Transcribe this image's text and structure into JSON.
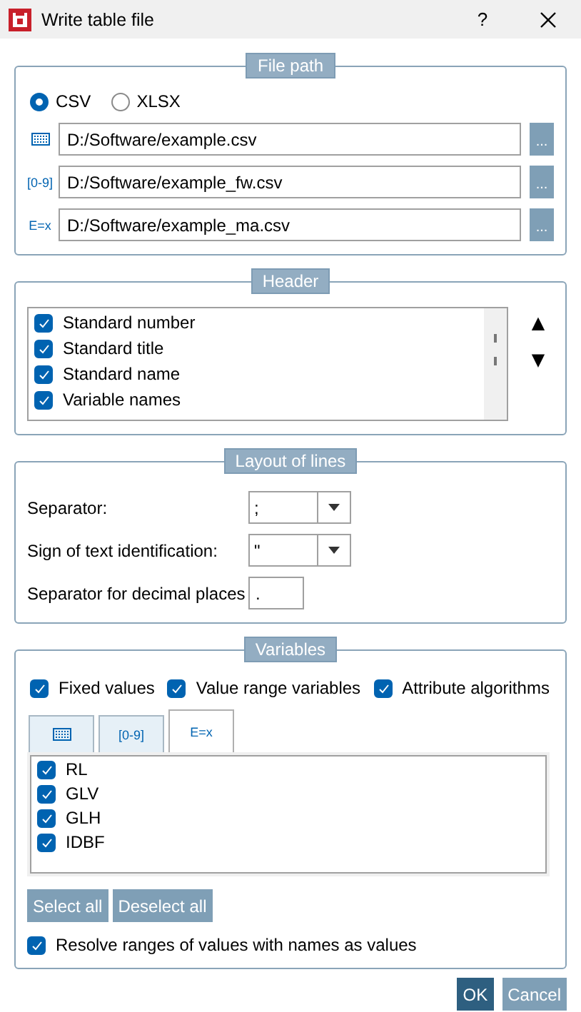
{
  "window": {
    "title": "Write table file",
    "help": "?"
  },
  "file_path": {
    "legend": "File path",
    "formats": [
      {
        "label": "CSV",
        "selected": true
      },
      {
        "label": "XLSX",
        "selected": false
      }
    ],
    "paths": [
      {
        "kind": "grid",
        "value": "D:/Software/example.csv",
        "browse": "..."
      },
      {
        "kind": "text",
        "icon_text": "[0-9]",
        "value": "D:/Software/example_fw.csv",
        "browse": "..."
      },
      {
        "kind": "text",
        "icon_text": "E=x",
        "value": "D:/Software/example_ma.csv",
        "browse": "..."
      }
    ]
  },
  "header": {
    "legend": "Header",
    "items": [
      {
        "label": "Standard number",
        "checked": true
      },
      {
        "label": "Standard title",
        "checked": true
      },
      {
        "label": "Standard name",
        "checked": true
      },
      {
        "label": "Variable names",
        "checked": true
      }
    ],
    "move_up": "▲",
    "move_down": "▼"
  },
  "layout_of_lines": {
    "legend": "Layout of lines",
    "fields": [
      {
        "kind": "combo",
        "label": "Separator:",
        "value": ";"
      },
      {
        "kind": "combo",
        "label": "Sign of text identification:",
        "value": "\""
      },
      {
        "kind": "text",
        "label": "Separator for decimal places",
        "value": "."
      }
    ]
  },
  "variables": {
    "legend": "Variables",
    "filters": [
      {
        "label": "Fixed values",
        "checked": true
      },
      {
        "label": "Value range variables",
        "checked": true
      },
      {
        "label": "Attribute algorithms",
        "checked": true
      }
    ],
    "tabs": [
      {
        "kind": "grid",
        "selected": false
      },
      {
        "kind": "text",
        "icon_text": "[0-9]",
        "selected": false
      },
      {
        "kind": "text",
        "icon_text": "E=x",
        "selected": true
      }
    ],
    "items": [
      {
        "label": "RL",
        "checked": true
      },
      {
        "label": "GLV",
        "checked": true
      },
      {
        "label": "GLH",
        "checked": true
      },
      {
        "label": "IDBF",
        "checked": true
      }
    ],
    "buttons": [
      "Select all",
      "Deselect all"
    ],
    "resolve": {
      "label": "Resolve ranges of values with names as values",
      "checked": true
    }
  },
  "footer": [
    {
      "label": "OK",
      "kind": "primary"
    },
    {
      "label": "Cancel",
      "kind": "secondary"
    }
  ]
}
